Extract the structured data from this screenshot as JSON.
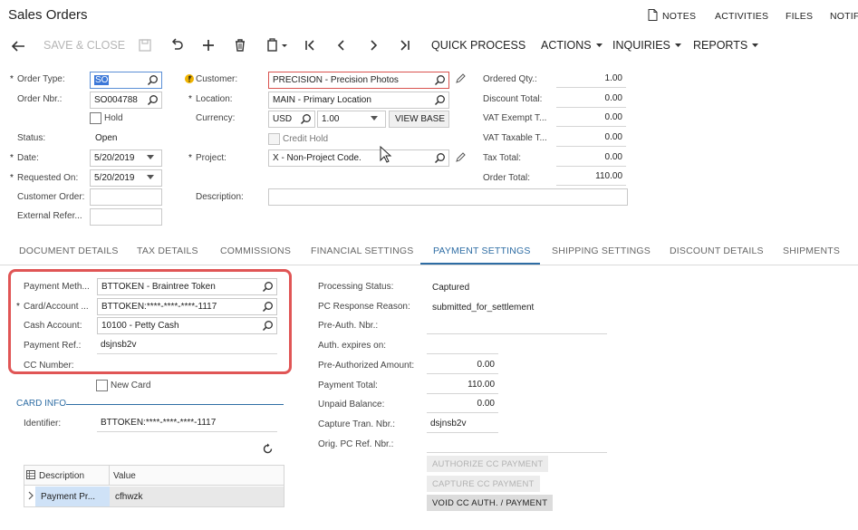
{
  "header": {
    "title": "Sales Orders",
    "links": [
      "NOTES",
      "ACTIVITIES",
      "FILES",
      "NOTIF"
    ]
  },
  "toolbar": {
    "save_close": "SAVE & CLOSE",
    "quick_process": "QUICK PROCESS",
    "actions": "ACTIONS",
    "inquiries": "INQUIRIES",
    "reports": "REPORTS"
  },
  "summary": {
    "order_type_label": "Order Type:",
    "order_type": "SO",
    "order_nbr_label": "Order Nbr.:",
    "order_nbr": "SO004788",
    "hold_label": "Hold",
    "status_label": "Status:",
    "status": "Open",
    "date_label": "Date:",
    "date": "5/20/2019",
    "requested_on_label": "Requested On:",
    "requested_on": "5/20/2019",
    "customer_order_label": "Customer Order:",
    "external_ref_label": "External Refer...",
    "customer_label": "Customer:",
    "customer": "PRECISION - Precision Photos",
    "location_label": "Location:",
    "location": "MAIN - Primary Location",
    "currency_label": "Currency:",
    "currency": "USD",
    "currency_rate": "1.00",
    "view_base": "VIEW BASE",
    "credit_hold_label": "Credit Hold",
    "project_label": "Project:",
    "project": "X - Non-Project Code.",
    "description_label": "Description:",
    "ordered_qty_label": "Ordered Qty.:",
    "ordered_qty": "1.00",
    "discount_total_label": "Discount Total:",
    "discount_total": "0.00",
    "vat_exempt_label": "VAT Exempt T...",
    "vat_exempt": "0.00",
    "vat_taxable_label": "VAT Taxable T...",
    "vat_taxable": "0.00",
    "tax_total_label": "Tax Total:",
    "tax_total": "0.00",
    "order_total_label": "Order Total:",
    "order_total": "110.00"
  },
  "tabs": [
    "DOCUMENT DETAILS",
    "TAX DETAILS",
    "COMMISSIONS",
    "FINANCIAL SETTINGS",
    "PAYMENT SETTINGS",
    "SHIPPING SETTINGS",
    "DISCOUNT DETAILS",
    "SHIPMENTS"
  ],
  "payment": {
    "method_label": "Payment Meth...",
    "method": "BTTOKEN - Braintree Token",
    "card_label": "Card/Account ...",
    "card": "BTTOKEN:****-****-****-1117",
    "cash_account_label": "Cash Account:",
    "cash_account": "10100 - Petty Cash",
    "payment_ref_label": "Payment Ref.:",
    "payment_ref": "dsjnsb2v",
    "cc_number_label": "CC Number:",
    "new_card_label": "New Card",
    "card_info_header": "CARD INFO",
    "identifier_label": "Identifier:",
    "identifier": "BTTOKEN:****-****-****-1117",
    "grid_headers": [
      "Description",
      "Value"
    ],
    "grid_row": {
      "description": "Payment Pr...",
      "value": "cfhwzk"
    }
  },
  "processing": {
    "status_label": "Processing Status:",
    "status": "Captured",
    "pc_response_label": "PC Response Reason:",
    "pc_response": "submitted_for_settlement",
    "preauth_nbr_label": "Pre-Auth. Nbr.:",
    "auth_expires_label": "Auth. expires on:",
    "preauth_amount_label": "Pre-Authorized Amount:",
    "preauth_amount": "0.00",
    "payment_total_label": "Payment Total:",
    "payment_total": "110.00",
    "unpaid_balance_label": "Unpaid Balance:",
    "unpaid_balance": "0.00",
    "capture_tran_label": "Capture Tran. Nbr.:",
    "capture_tran": "dsjnsb2v",
    "orig_pc_ref_label": "Orig. PC Ref. Nbr.:",
    "btn_authorize": "AUTHORIZE CC PAYMENT",
    "btn_capture": "CAPTURE CC PAYMENT",
    "btn_void": "VOID CC AUTH. / PAYMENT"
  },
  "colors": {
    "accent": "#2e6da4",
    "highlight_border": "#e05555",
    "error_border": "#d9534f",
    "selected_text": "#2f6fb5"
  }
}
